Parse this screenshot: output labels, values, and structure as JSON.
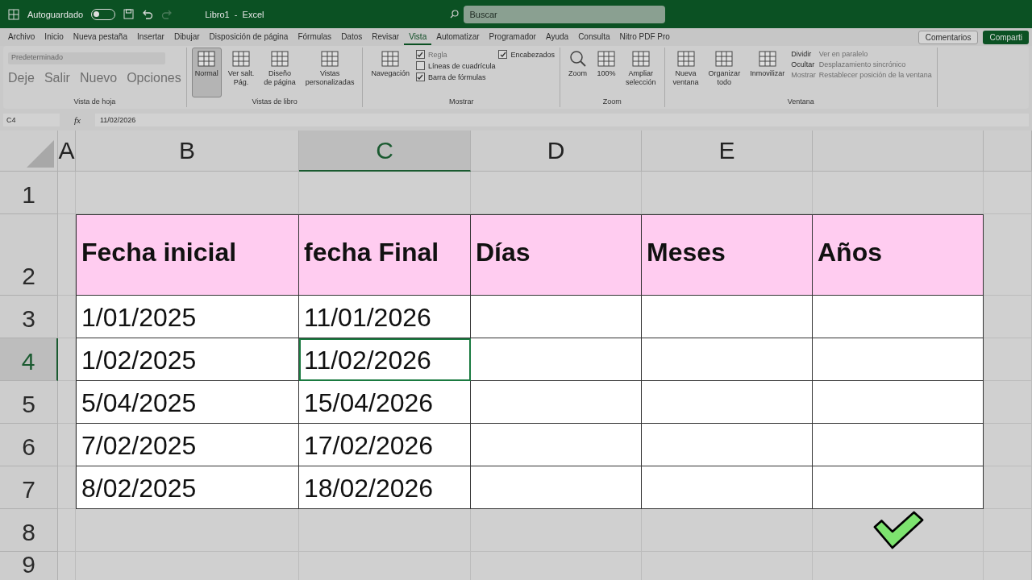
{
  "title_bar": {
    "autosave_label": "Autoguardado",
    "autosave_on": false,
    "document_title": "Libro1  -  Excel",
    "search_placeholder": "Buscar"
  },
  "menu_tabs": [
    {
      "label": "Archivo",
      "selected": false
    },
    {
      "label": "Inicio",
      "selected": false
    },
    {
      "label": "Nueva pestaña",
      "selected": false
    },
    {
      "label": "Insertar",
      "selected": false
    },
    {
      "label": "Dibujar",
      "selected": false
    },
    {
      "label": "Disposición de página",
      "selected": false
    },
    {
      "label": "Fórmulas",
      "selected": false
    },
    {
      "label": "Datos",
      "selected": false
    },
    {
      "label": "Revisar",
      "selected": false
    },
    {
      "label": "Vista",
      "selected": true
    },
    {
      "label": "Automatizar",
      "selected": false
    },
    {
      "label": "Programador",
      "selected": false
    },
    {
      "label": "Ayuda",
      "selected": false
    },
    {
      "label": "Consulta",
      "selected": false
    },
    {
      "label": "Nitro PDF Pro",
      "selected": false
    }
  ],
  "comments_button": "Comentarios",
  "share_button": "Comparti",
  "ribbon_groups": [
    {
      "label": "Vista de hoja",
      "columns": [
        {
          "kind": "sheetview",
          "dropdown": "Predeterminado",
          "items": [
            {
              "label": "Deje",
              "disabled": true
            },
            {
              "label": "Salir",
              "disabled": true
            },
            {
              "label": "Nuevo",
              "disabled": true
            },
            {
              "label": "Opciones",
              "disabled": true
            }
          ]
        }
      ]
    },
    {
      "label": "Vistas de libro",
      "columns": [
        {
          "kind": "large",
          "label": "Normal",
          "selected": true
        },
        {
          "kind": "large",
          "label": "Ver salt.\nPág.",
          "selected": false
        },
        {
          "kind": "large",
          "label": "Diseño\nde página",
          "selected": false
        },
        {
          "kind": "large",
          "label": "Vistas\npersonalizadas",
          "selected": false
        }
      ]
    },
    {
      "label": "Mostrar",
      "columns": [
        {
          "kind": "large",
          "label": "Navegación",
          "selected": false
        },
        {
          "kind": "stack",
          "items": [
            {
              "kind": "check",
              "label": "Regla",
              "checked": true,
              "disabled": true
            },
            {
              "kind": "check",
              "label": "Líneas de cuadrícula",
              "checked": false,
              "disabled": false
            },
            {
              "kind": "check",
              "label": "Barra de fórmulas",
              "checked": true,
              "disabled": false
            }
          ]
        },
        {
          "kind": "stack",
          "items": [
            {
              "kind": "check",
              "label": "Encabezados",
              "checked": true,
              "disabled": false
            }
          ]
        }
      ]
    },
    {
      "label": "Zoom",
      "columns": [
        {
          "kind": "large",
          "label": "Zoom",
          "selected": false
        },
        {
          "kind": "large",
          "label": "100%",
          "selected": false
        },
        {
          "kind": "large",
          "label": "Ampliar\nselección",
          "selected": false
        }
      ]
    },
    {
      "label": "Ventana",
      "columns": [
        {
          "kind": "large",
          "label": "Nueva\nventana",
          "selected": false
        },
        {
          "kind": "large",
          "label": "Organizar\ntodo",
          "selected": false
        },
        {
          "kind": "large",
          "label": "Inmovilizar",
          "selected": false
        },
        {
          "kind": "stack",
          "items": [
            {
              "kind": "small",
              "label": "Dividir",
              "disabled": false
            },
            {
              "kind": "small",
              "label": "Ocultar",
              "disabled": false
            },
            {
              "kind": "small",
              "label": "Mostrar",
              "disabled": true
            }
          ]
        },
        {
          "kind": "stack",
          "items": [
            {
              "kind": "small",
              "label": "Ver en paralelo",
              "disabled": true
            },
            {
              "kind": "small",
              "label": "Desplazamiento sincrónico",
              "disabled": true
            },
            {
              "kind": "small",
              "label": "Restablecer posición de la ventana",
              "disabled": true
            }
          ]
        }
      ]
    }
  ],
  "formula_bar": {
    "name_box": "C4",
    "fx": "fx",
    "value": "11/02/2026"
  },
  "sheet": {
    "columns": [
      {
        "label": "A",
        "selected": false
      },
      {
        "label": "B",
        "selected": false
      },
      {
        "label": "C",
        "selected": true
      },
      {
        "label": "D",
        "selected": false
      },
      {
        "label": "E",
        "selected": false
      }
    ],
    "row_headers": [
      {
        "label": "1",
        "selected": false
      },
      {
        "label": "2",
        "selected": false
      },
      {
        "label": "3",
        "selected": false
      },
      {
        "label": "4",
        "selected": true
      },
      {
        "label": "5",
        "selected": false
      },
      {
        "label": "6",
        "selected": false
      },
      {
        "label": "7",
        "selected": false
      },
      {
        "label": "8",
        "selected": false
      },
      {
        "label": "9",
        "selected": false
      }
    ],
    "table_header": [
      "Fecha inicial",
      "fecha Final",
      "Días",
      "Meses",
      "Años"
    ],
    "table_rows": [
      {
        "cells": [
          {
            "text": "1/01/2025",
            "selected": false
          },
          {
            "text": "11/01/2026",
            "selected": false
          },
          {
            "selected": false
          },
          {
            "selected": false
          },
          {
            "selected": false
          }
        ]
      },
      {
        "cells": [
          {
            "text": "1/02/2025",
            "selected": false
          },
          {
            "text": "11/02/2026",
            "selected": true
          },
          {
            "selected": false
          },
          {
            "selected": false
          },
          {
            "selected": false
          }
        ]
      },
      {
        "cells": [
          {
            "text": "5/04/2025",
            "selected": false
          },
          {
            "text": "15/04/2026",
            "selected": false
          },
          {
            "selected": false
          },
          {
            "selected": false
          },
          {
            "selected": false
          }
        ]
      },
      {
        "cells": [
          {
            "text": "7/02/2025",
            "selected": false
          },
          {
            "text": "17/02/2026",
            "selected": false
          },
          {
            "selected": false
          },
          {
            "selected": false
          },
          {
            "selected": false
          }
        ]
      },
      {
        "cells": [
          {
            "text": "8/02/2025",
            "selected": false
          },
          {
            "text": "18/02/2026",
            "selected": false
          },
          {
            "selected": false
          },
          {
            "selected": false
          },
          {
            "selected": false
          }
        ]
      }
    ]
  }
}
